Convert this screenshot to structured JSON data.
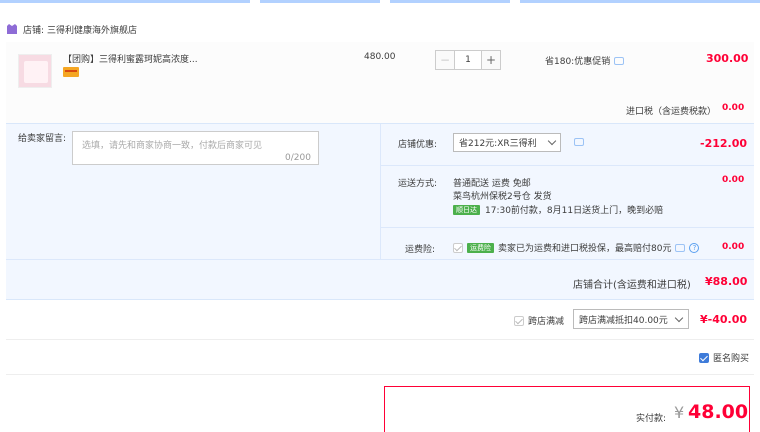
{
  "store": {
    "label": "店铺:",
    "name": "三得利健康海外旗舰店"
  },
  "item": {
    "title": "【团购】三得利蜜露珂妮高浓度...",
    "unit_price": "480.00",
    "quantity": "1",
    "promo": "省180:优惠促销",
    "subtotal": "300.00"
  },
  "import_tax": {
    "label": "进口税（含运费税款）",
    "value": "0.00"
  },
  "memo": {
    "label": "给卖家留言:",
    "placeholder": "选填，请先和商家协商一致，付款后商家可见",
    "count": "0/200"
  },
  "store_discount": {
    "label": "店铺优惠:",
    "selected": "省212元:XR三得利",
    "value": "-212.00"
  },
  "shipping": {
    "label": "运送方式:",
    "method": "普通配送 运费 免邮",
    "warehouse": "菜鸟杭州保税2号仓  发货",
    "tag": "顺日达",
    "promise": "17:30前付款，8月11日送货上门，晚到必赔",
    "value": "0.00"
  },
  "insurance": {
    "label": "运费险:",
    "tag": "运费险",
    "text": "卖家已为运费和进口税投保，最高赔付80元",
    "value": "0.00"
  },
  "store_total": {
    "label": "店铺合计(含运费和进口税)",
    "value": "¥88.00"
  },
  "cross_store": {
    "label": "跨店满减",
    "selected": "跨店满减抵扣40.00元",
    "value": "¥-40.00"
  },
  "anonymous": {
    "label": "匿名购买"
  },
  "payment": {
    "label": "实付款:",
    "currency": "¥",
    "value": "48.00"
  },
  "colors": {
    "accent_red": "#ff0036",
    "panel_blue": "#f2f7ff",
    "link_blue": "#3e7bd9"
  },
  "icons": [
    "store-icon",
    "card-icon",
    "message-icon",
    "help-icon",
    "chevron-down-icon"
  ]
}
